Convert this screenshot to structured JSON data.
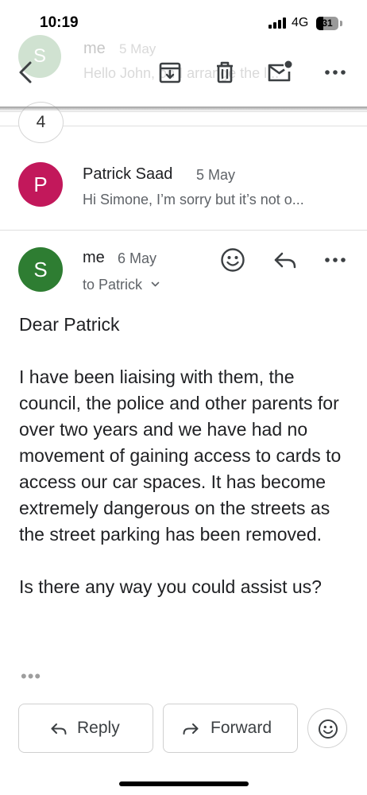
{
  "status_bar": {
    "time": "10:19",
    "network": "4G",
    "battery": "31"
  },
  "previous_message": {
    "avatar_initial": "S",
    "sender": "me",
    "date": "5 May",
    "snippet": "Hello John, on I arrange the l..."
  },
  "toolbar": {
    "icons": [
      "back-arrow-icon",
      "archive-icon",
      "delete-icon",
      "mark-unread-icon",
      "more-options-icon"
    ]
  },
  "collapsed_count": "4",
  "thread": [
    {
      "avatar_initial": "P",
      "avatar_color": "#c2185b",
      "sender": "Patrick Saad",
      "date": "5 May",
      "snippet": "Hi Simone, I’m sorry but it’s not o..."
    }
  ],
  "open_message": {
    "avatar_initial": "S",
    "avatar_color": "#2e7d32",
    "sender": "me",
    "date": "6 May",
    "to_line": "to Patrick",
    "greeting": "Dear Patrick",
    "paragraphs": [
      "I have been liaising with them, the council, the police and other parents for over two years and we have had no movement of gaining access to cards to access our car spaces. It has become extremely dangerous on the streets as the street parking has been removed.",
      "Is there any way you could assist us?"
    ],
    "trimmed_content": "•••"
  },
  "actions": {
    "reply": "Reply",
    "forward": "Forward"
  }
}
